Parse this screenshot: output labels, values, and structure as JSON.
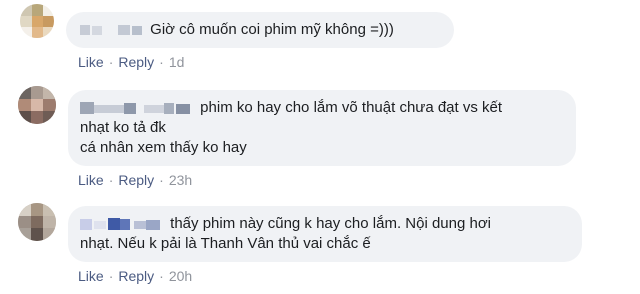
{
  "comments": [
    {
      "text_lines": [
        "Giờ cô muốn coi phim mỹ không =)))"
      ],
      "like_label": "Like",
      "reply_label": "Reply",
      "separator": "·",
      "time": "1d"
    },
    {
      "text_lines": [
        "phim ko hay cho lắm võ thuật chưa đạt vs kết",
        "nhạt ko tả đk",
        "cá nhân xem thấy ko hay"
      ],
      "like_label": "Like",
      "reply_label": "Reply",
      "separator": "·",
      "time": "23h"
    },
    {
      "text_lines": [
        "thấy phim này cũng k hay cho lắm. Nội dung hơi",
        "nhạt. Nếu k pải là Thanh Vân thủ vai chắc ế"
      ],
      "like_label": "Like",
      "reply_label": "Reply",
      "separator": "·",
      "time": "20h"
    }
  ],
  "colors": {
    "bubble_bg": "#f0f2f5",
    "link": "#4b5b82",
    "meta": "#90949c"
  }
}
